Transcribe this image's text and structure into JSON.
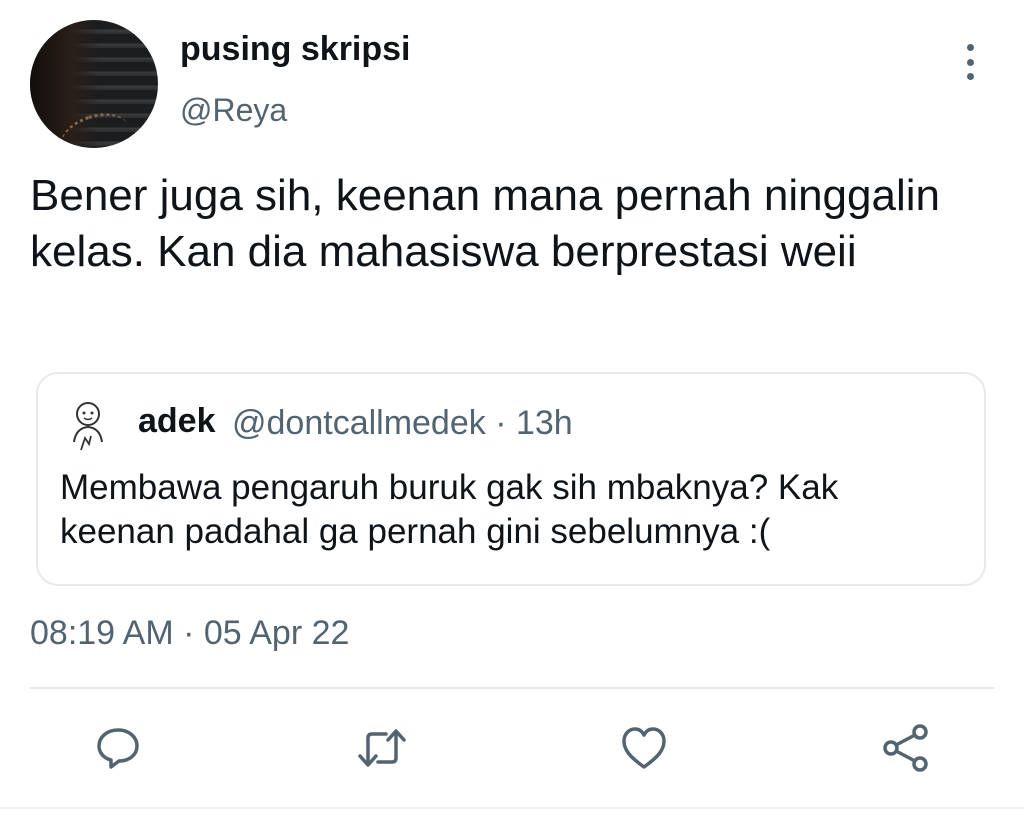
{
  "tweet": {
    "display_name": "pusing skripsi",
    "handle": "@Reya",
    "text": "Bener juga sih, keenan mana pernah ninggalin kelas. Kan dia mahasiswa berprestasi weii",
    "timestamp": "08:19 AM · 05 Apr 22"
  },
  "quoted_tweet": {
    "display_name": "adek",
    "meta": "@dontcallmedek · 13h",
    "text": "Membawa pengaruh buruk gak sih mbaknya? Kak keenan padahal ga pernah gini sebelumnya :("
  },
  "actions": [
    {
      "icon": "reply-icon"
    },
    {
      "icon": "retweet-icon"
    },
    {
      "icon": "like-icon"
    },
    {
      "icon": "share-icon"
    }
  ],
  "colors": {
    "text_primary": "#0f1419",
    "text_secondary": "#536471",
    "border": "#e6e9eb",
    "icon": "#536471"
  }
}
